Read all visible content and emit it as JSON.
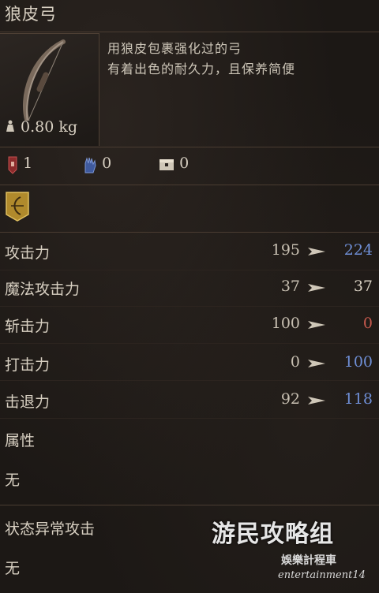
{
  "item": {
    "name": "狼皮弓",
    "description_lines": [
      "用狼皮包裹强化过的弓",
      "有着出色的耐久力，且保养简便"
    ],
    "weight": "0.80 kg"
  },
  "requirements": [
    {
      "icon": "strength-icon",
      "value": "1"
    },
    {
      "icon": "intelligence-hand-icon",
      "value": "0"
    },
    {
      "icon": "chest-icon",
      "value": "0"
    }
  ],
  "skill_icon": "bow-skill-icon",
  "stats": [
    {
      "label": "攻击力",
      "base": "195",
      "new": "224",
      "new_color": "#6f8fd6"
    },
    {
      "label": "魔法攻击力",
      "base": "37",
      "new": "37",
      "new_color": "#d8d0c2"
    },
    {
      "label": "斩击力",
      "base": "100",
      "new": "0",
      "new_color": "#c85a4e"
    },
    {
      "label": "打击力",
      "base": "0",
      "new": "100",
      "new_color": "#6f8fd6"
    },
    {
      "label": "击退力",
      "base": "92",
      "new": "118",
      "new_color": "#6f8fd6"
    }
  ],
  "attribute": {
    "label": "属性",
    "value": "无"
  },
  "status_attack": {
    "label": "状态异常攻击",
    "value": "无"
  },
  "watermark": {
    "logo": "游民攻略组",
    "channel": "娛樂計程車",
    "channel_en": "entertainment14"
  }
}
